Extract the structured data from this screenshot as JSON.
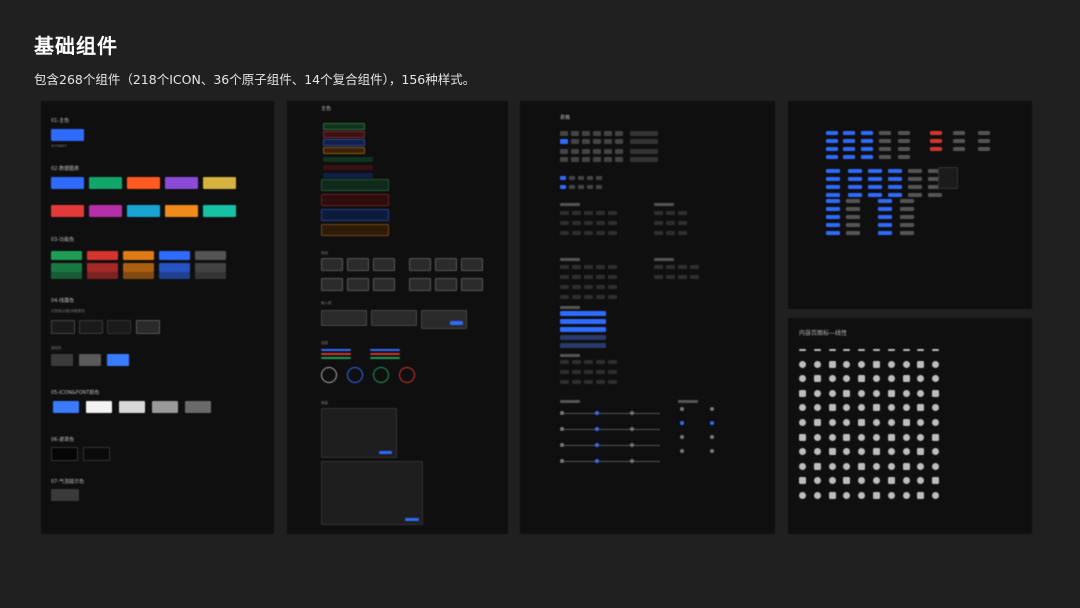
{
  "header": {
    "title": "基础组件",
    "subtitle": "包含268个组件（218个ICON、36个原子组件、14个复合组件），156种样式。"
  },
  "panel1": {
    "sections": {
      "main_color": "01-主色",
      "chart_color": "02-数据图表",
      "function_color": "03-功能色",
      "line_color": "04-线露色",
      "icon_color": "05-ICON&FONT颜色",
      "mask_color": "06-遮罩色",
      "bubble_color": "07-气泡提示色"
    },
    "colors": {
      "main": "#2f6bff",
      "chart_row1": [
        "#2f6bff",
        "#13a66b",
        "#ff5a1f",
        "#8a4bd8",
        "#d6b23f"
      ],
      "chart_row2": [
        "#e23a3a",
        "#b52fa8",
        "#1aa4d4",
        "#f08a1a",
        "#16c2a4"
      ],
      "function": [
        "#1f9d55",
        "#d6342f",
        "#e07b14",
        "#2f6bff",
        "#555555"
      ],
      "icon": [
        "#3a7bff",
        "#f2f2f2",
        "#d8d8d8",
        "#9a9a9a",
        "#6a6a6a"
      ]
    }
  },
  "panel2": {
    "title": "主色"
  },
  "panel3": {
    "title": "表格"
  },
  "panel5": {
    "title": "内容页图标—线性"
  }
}
